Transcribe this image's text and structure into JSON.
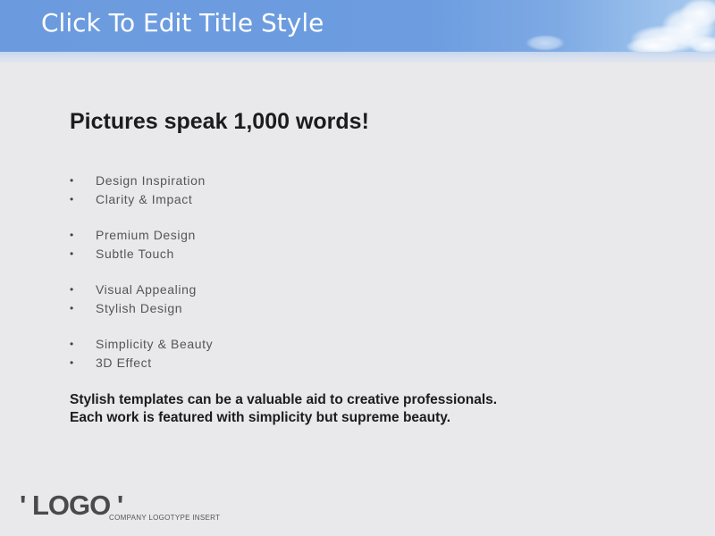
{
  "header": {
    "title": "Click To Edit Title Style"
  },
  "slide": {
    "heading": "Pictures speak 1,000 words!",
    "bullet_groups": [
      [
        "Design Inspiration",
        "Clarity & Impact"
      ],
      [
        "Premium Design",
        "Subtle Touch"
      ],
      [
        "Visual Appealing",
        "Stylish Design"
      ],
      [
        "Simplicity & Beauty",
        "3D Effect"
      ]
    ],
    "paragraph_lines": [
      "Stylish templates can be a valuable aid to creative professionals.",
      "Each work is featured with simplicity but supreme beauty."
    ]
  },
  "footer": {
    "logo": "' LOGO '",
    "logo_caption": "COMPANY LOGOTYPE INSERT"
  },
  "icons": {
    "bullet": "bullet-dot-icon",
    "bullet_glyph": "•"
  },
  "colors": {
    "header_blue": "#6b9bde",
    "background": "#e9e9eb",
    "title_text": "#ffffff",
    "body_text": "#1c1c1c"
  }
}
